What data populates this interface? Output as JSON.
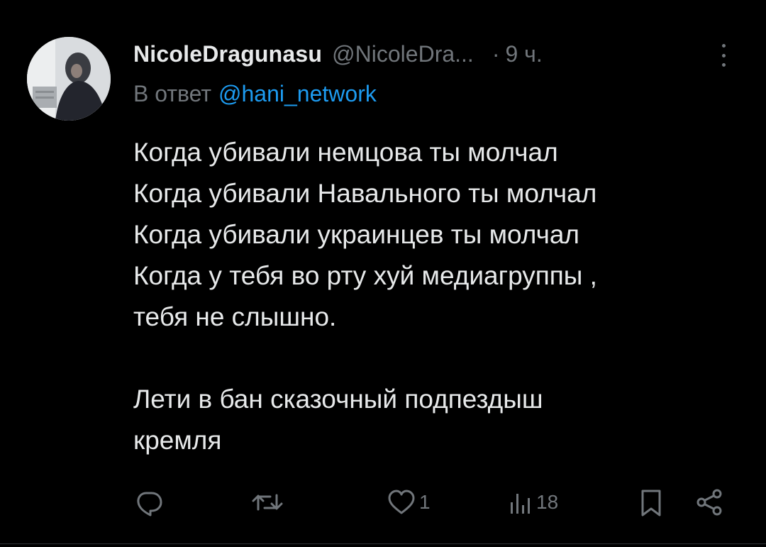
{
  "tweet": {
    "author": {
      "display_name": "NicoleDragunasu",
      "handle": "@NicoleDra...",
      "separator": "·",
      "time": "9 ч."
    },
    "reply": {
      "prefix": "В ответ",
      "to": "@hani_network"
    },
    "body": {
      "lines": [
        "Когда убивали немцова ты молчал",
        "Когда убивали Навального ты молчал",
        "Когда убивали украинцев ты молчал",
        "Когда у тебя во рту хуй медиагруппы ,",
        "тебя не слышно."
      ],
      "lines2": [
        "Лети в бан сказочный подпездыш",
        "кремля"
      ]
    },
    "actions": {
      "reply": {
        "icon": "reply-icon",
        "count": ""
      },
      "repost": {
        "icon": "repost-icon",
        "count": ""
      },
      "like": {
        "icon": "heart-icon",
        "count": "1"
      },
      "views": {
        "icon": "views-icon",
        "count": "18"
      },
      "bookmark": {
        "icon": "bookmark-icon",
        "count": ""
      },
      "share": {
        "icon": "share-icon",
        "count": ""
      }
    }
  },
  "colors": {
    "background": "#000000",
    "text": "#e7e9ea",
    "secondary": "#71767b",
    "link": "#1d9bf0"
  }
}
